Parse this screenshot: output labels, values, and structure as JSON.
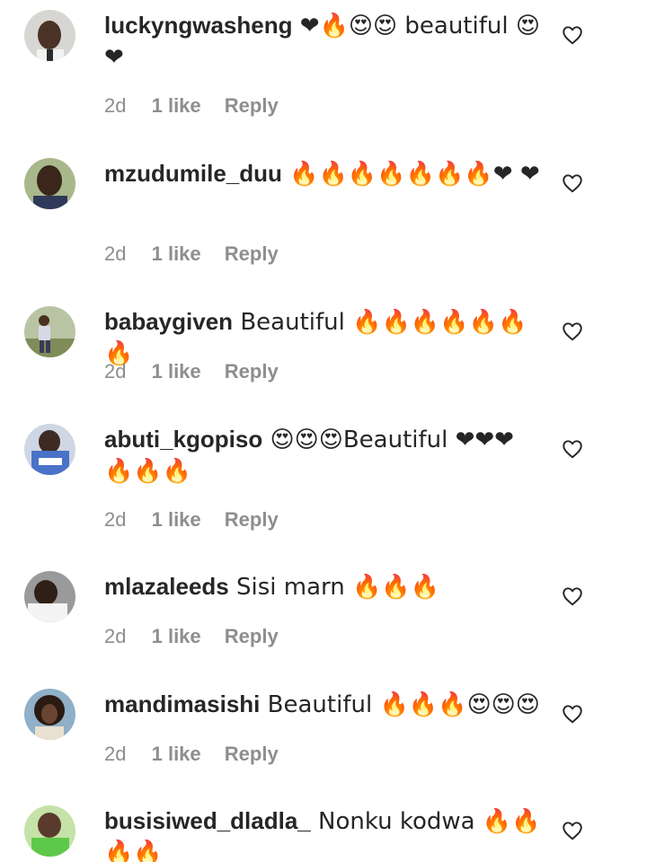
{
  "comments": [
    {
      "username": "luckyngwasheng",
      "text": " ❤🔥😍😍 beautiful 😍❤",
      "time": "2d",
      "likes": "1 like",
      "reply": "Reply",
      "avatar": "avatar-man-portrait"
    },
    {
      "username": "mzudumile_duu",
      "text": " 🔥🔥🔥🔥🔥🔥🔥❤ ❤",
      "time": "2d",
      "likes": "1 like",
      "reply": "Reply",
      "avatar": "avatar-man-dark"
    },
    {
      "username": "babaygiven",
      "text": " Beautiful 🔥🔥🔥🔥🔥🔥🔥",
      "time": "2d",
      "likes": "1 like",
      "reply": "Reply",
      "avatar": "avatar-outdoor"
    },
    {
      "username": "abuti_kgopiso",
      "text": " 😍😍😍Beautiful ❤❤❤ 🔥🔥🔥",
      "time": "2d",
      "likes": "1 like",
      "reply": "Reply",
      "avatar": "avatar-woman-blue"
    },
    {
      "username": "mlazaleeds",
      "text": " Sisi marn 🔥🔥🔥",
      "time": "2d",
      "likes": "1 like",
      "reply": "Reply",
      "avatar": "avatar-man-white-shirt"
    },
    {
      "username": "mandimasishi",
      "text": " Beautiful 🔥🔥🔥😍😍😍",
      "time": "2d",
      "likes": "1 like",
      "reply": "Reply",
      "avatar": "avatar-woman-curly"
    },
    {
      "username": "busisiwed_dladla_",
      "text": " Nonku kodwa 🔥🔥 🔥🔥",
      "time": "",
      "likes": "",
      "reply": "",
      "avatar": "avatar-woman-green"
    }
  ],
  "icons": {
    "like": "heart-outline-icon"
  },
  "colors": {
    "text": "#262626",
    "meta": "#8e8e8e"
  }
}
